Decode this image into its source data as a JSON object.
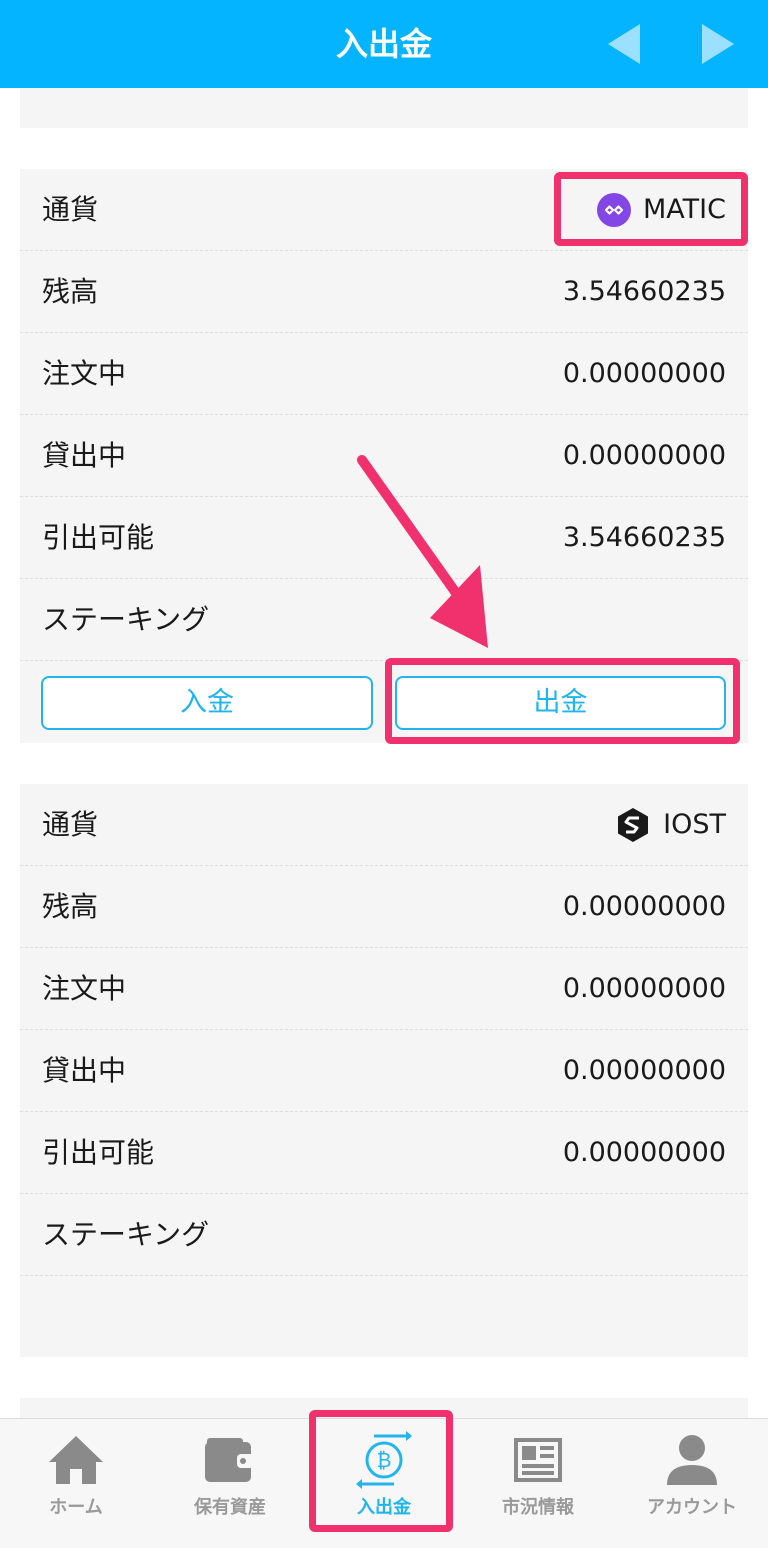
{
  "header": {
    "title": "入出金",
    "prev_icon": "chevron-left-icon",
    "next_icon": "chevron-right-icon"
  },
  "accent_color": "#05b4ff",
  "highlight_color": "#f0316e",
  "cards": [
    {
      "currency": {
        "label": "通貨",
        "name": "MATIC",
        "icon": "matic-icon",
        "icon_color": "#8247e5"
      },
      "rows": [
        {
          "label": "残高",
          "value": "3.54660235"
        },
        {
          "label": "注文中",
          "value": "0.00000000"
        },
        {
          "label": "貸出中",
          "value": "0.00000000"
        },
        {
          "label": "引出可能",
          "value": "3.54660235"
        },
        {
          "label": "ステーキング",
          "value": ""
        }
      ],
      "buttons": {
        "deposit": "入金",
        "withdraw": "出金"
      }
    },
    {
      "currency": {
        "label": "通貨",
        "name": "IOST",
        "icon": "iost-icon"
      },
      "rows": [
        {
          "label": "残高",
          "value": "0.00000000"
        },
        {
          "label": "注文中",
          "value": "0.00000000"
        },
        {
          "label": "貸出中",
          "value": "0.00000000"
        },
        {
          "label": "引出可能",
          "value": "0.00000000"
        },
        {
          "label": "ステーキング",
          "value": ""
        }
      ]
    }
  ],
  "tabbar": {
    "items": [
      {
        "label": "ホーム",
        "icon": "home-icon",
        "active": false
      },
      {
        "label": "保有資産",
        "icon": "wallet-icon",
        "active": false
      },
      {
        "label": "入出金",
        "icon": "bitcoin-transfer-icon",
        "active": true
      },
      {
        "label": "市況情報",
        "icon": "news-icon",
        "active": false
      },
      {
        "label": "アカウント",
        "icon": "account-icon",
        "active": false
      }
    ]
  }
}
